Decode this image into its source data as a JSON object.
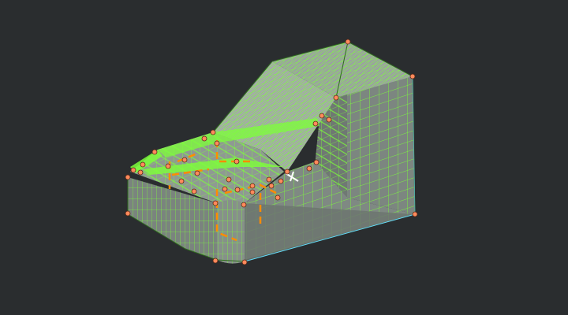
{
  "viewport": {
    "name": "3d-cad-viewport",
    "model": "mesh-model",
    "colors": {
      "background": "#2a2d2f",
      "mesh_line": "#7dff3a",
      "mesh_fill": "#8f9a93",
      "highlight_edge": "#ff8c00",
      "control_point": "#ff8a5c",
      "control_point_stroke": "#5a2a18",
      "boundary_edge": "#66d9ff",
      "cursor": "#ffffff"
    },
    "control_point_count": 38
  }
}
